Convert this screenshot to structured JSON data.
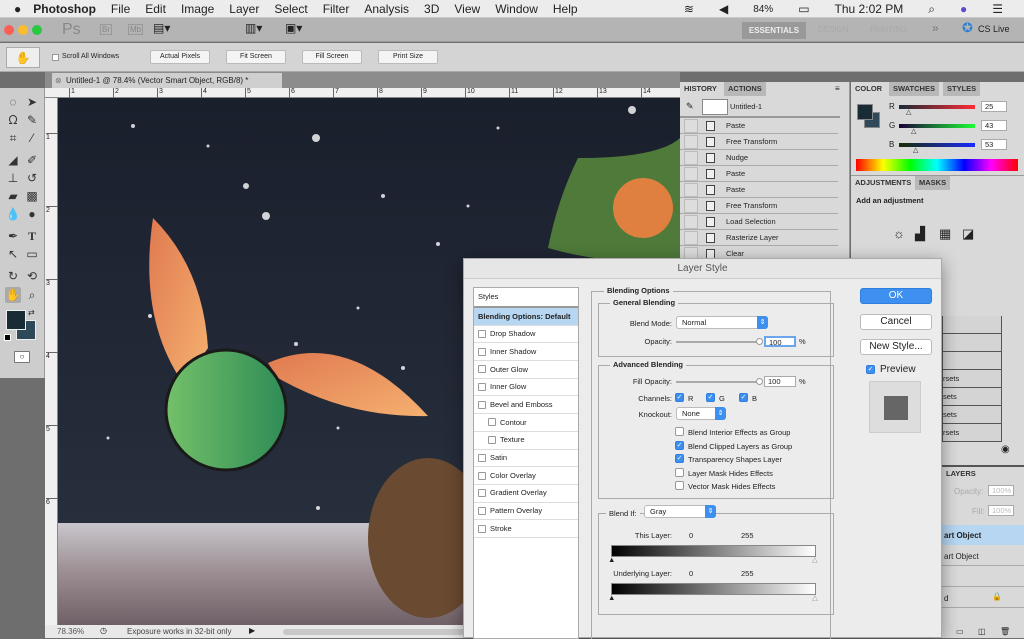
{
  "menubar": {
    "apple": "",
    "app": "Photoshop",
    "items": [
      "File",
      "Edit",
      "Image",
      "Layer",
      "Select",
      "Filter",
      "Analysis",
      "3D",
      "View",
      "Window",
      "Help"
    ],
    "battery": "84%",
    "clock": "Thu 2:02 PM"
  },
  "appbar": {
    "ps": "Ps",
    "br": "Br",
    "mb": "Mb",
    "workspaces": [
      "ESSENTIALS",
      "DESIGN",
      "PAINTING"
    ],
    "more": "»",
    "cslive": "CS Live"
  },
  "options": {
    "scroll_all": "Scroll All Windows",
    "buttons": [
      "Actual Pixels",
      "Fit Screen",
      "Fill Screen",
      "Print Size"
    ]
  },
  "document": {
    "tab": "Untitled-1 @ 78.4% (Vector Smart Object, RGB/8) *",
    "zoom": "78.36%",
    "status": "Exposure works in 32-bit only",
    "ruler_top": [
      "1",
      "2",
      "3",
      "4",
      "5",
      "6",
      "7",
      "8",
      "9",
      "10",
      "11",
      "12",
      "13",
      "14"
    ],
    "ruler_left": [
      "1",
      "2",
      "3",
      "4",
      "5",
      "6"
    ]
  },
  "history": {
    "tabs": [
      "HISTORY",
      "ACTIONS"
    ],
    "snapshot": "Untitled-1",
    "items": [
      "Paste",
      "Free Transform",
      "Nudge",
      "Paste",
      "Paste",
      "Free Transform",
      "Load Selection",
      "Rasterize Layer",
      "Clear"
    ]
  },
  "color": {
    "tabs": [
      "COLOR",
      "SWATCHES",
      "STYLES"
    ],
    "r_label": "R",
    "g_label": "G",
    "b_label": "B",
    "r": "25",
    "g": "43",
    "b": "53",
    "foreground": "#192b35",
    "background": "#2e4a5a"
  },
  "adjustments": {
    "tabs": [
      "ADJUSTMENTS",
      "MASKS"
    ],
    "title": "Add an adjustment",
    "presets": [
      "",
      "",
      "",
      "rsets",
      "sets",
      "sets",
      "rsets"
    ]
  },
  "layers": {
    "tab": "LAYERS",
    "opacity_label": "Opacity:",
    "opacity": "100%",
    "fill_label": "Fill:",
    "fill": "100%",
    "rows": [
      "art Object",
      "art Object",
      "",
      "d"
    ]
  },
  "dialog": {
    "title": "Layer Style",
    "styles_header": "Styles",
    "styles": [
      {
        "label": "Blending Options: Default",
        "selected": true,
        "checkbox": false
      },
      {
        "label": "Drop Shadow",
        "checkbox": true
      },
      {
        "label": "Inner Shadow",
        "checkbox": true
      },
      {
        "label": "Outer Glow",
        "checkbox": true
      },
      {
        "label": "Inner Glow",
        "checkbox": true
      },
      {
        "label": "Bevel and Emboss",
        "checkbox": true
      },
      {
        "label": "Contour",
        "checkbox": true,
        "indent": true
      },
      {
        "label": "Texture",
        "checkbox": true,
        "indent": true
      },
      {
        "label": "Satin",
        "checkbox": true
      },
      {
        "label": "Color Overlay",
        "checkbox": true
      },
      {
        "label": "Gradient Overlay",
        "checkbox": true
      },
      {
        "label": "Pattern Overlay",
        "checkbox": true
      },
      {
        "label": "Stroke",
        "checkbox": true
      }
    ],
    "blending_options": "Blending Options",
    "general": "General Blending",
    "blend_mode_label": "Blend Mode:",
    "blend_mode": "Normal",
    "opacity_label": "Opacity:",
    "opacity": "100",
    "pct": "%",
    "advanced": "Advanced Blending",
    "fill_label": "Fill Opacity:",
    "fill": "100",
    "channels_label": "Channels:",
    "channels": [
      "R",
      "G",
      "B"
    ],
    "knockout_label": "Knockout:",
    "knockout": "None",
    "options": [
      {
        "label": "Blend Interior Effects as Group",
        "checked": false
      },
      {
        "label": "Blend Clipped Layers as Group",
        "checked": true
      },
      {
        "label": "Transparency Shapes Layer",
        "checked": true
      },
      {
        "label": "Layer Mask Hides Effects",
        "checked": false
      },
      {
        "label": "Vector Mask Hides Effects",
        "checked": false
      }
    ],
    "blend_if_label": "Blend If:",
    "blend_if": "Gray",
    "this_layer": "This Layer:",
    "underlying": "Underlying Layer:",
    "lo": "0",
    "hi": "255",
    "ok": "OK",
    "cancel": "Cancel",
    "new_style": "New Style...",
    "preview": "Preview"
  },
  "colors": {
    "accent": "#3d8ff0",
    "selection": "#b6d6f2"
  }
}
